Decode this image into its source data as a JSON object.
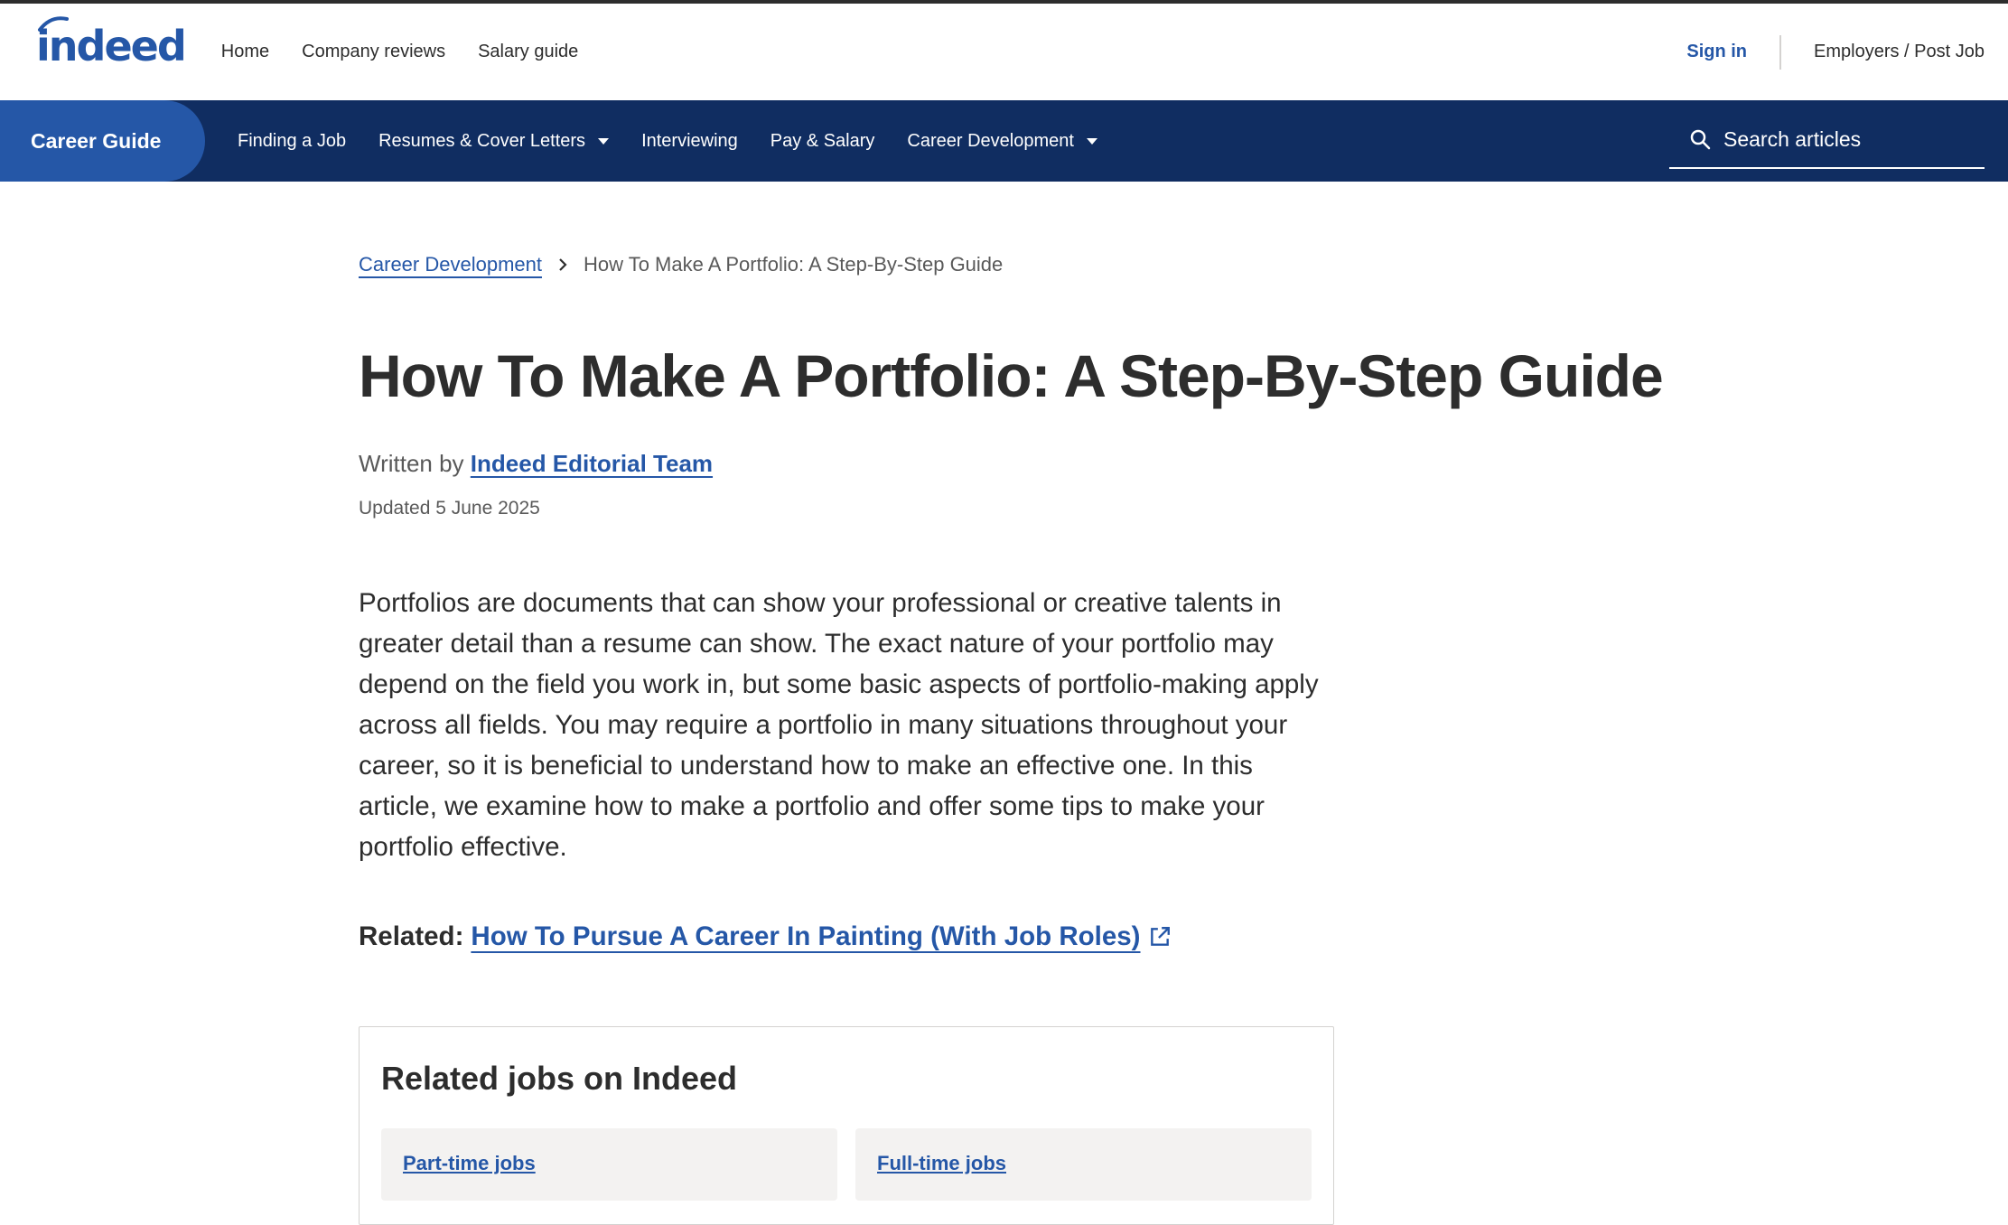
{
  "header": {
    "logo": "indeed",
    "nav": [
      "Home",
      "Company reviews",
      "Salary guide"
    ],
    "signin": "Sign in",
    "employers": "Employers / Post Job"
  },
  "subnav": {
    "section": "Career Guide",
    "items": [
      {
        "label": "Finding a Job",
        "dropdown": false
      },
      {
        "label": "Resumes & Cover Letters",
        "dropdown": true
      },
      {
        "label": "Interviewing",
        "dropdown": false
      },
      {
        "label": "Pay & Salary",
        "dropdown": false
      },
      {
        "label": "Career Development",
        "dropdown": true
      }
    ],
    "search_label": "Search articles"
  },
  "breadcrumb": {
    "parent": "Career Development",
    "current": "How To Make A Portfolio: A Step-By-Step Guide"
  },
  "article": {
    "title": "How To Make A Portfolio: A Step-By-Step Guide",
    "written_by": "Written by",
    "author": "Indeed Editorial Team",
    "updated": "Updated 5 June 2025",
    "intro": "Portfolios are documents that can show your professional or creative talents in greater detail than a resume can show. The exact nature of your portfolio may depend on the field you work in, but some basic aspects of portfolio-making apply across all fields. You may require a portfolio in many situations throughout your career, so it is beneficial to understand how to make an effective one. In this article, we examine how to make a portfolio and offer some tips to make your portfolio effective.",
    "related_label": "Related:",
    "related_link": "How To Pursue A Career In Painting (With Job Roles)"
  },
  "related_jobs": {
    "title": "Related jobs on Indeed",
    "cards": [
      "Part-time jobs",
      "Full-time jobs"
    ]
  },
  "colors": {
    "brand_blue": "#2557a7",
    "navy": "#102d61",
    "text": "#2d2d2d"
  }
}
